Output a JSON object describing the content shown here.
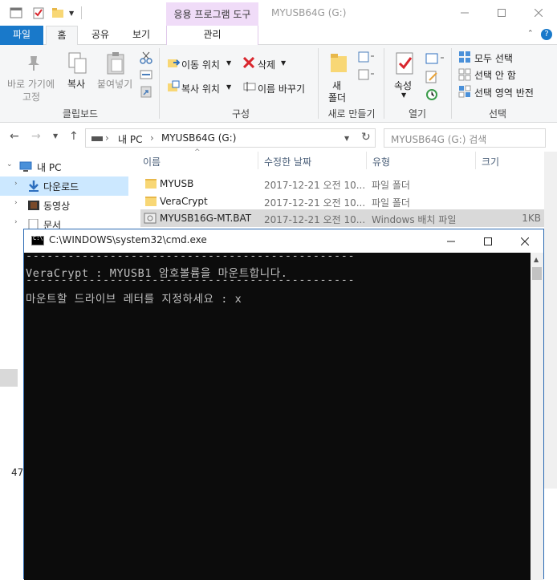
{
  "explorer": {
    "context_tab": "응용 프로그램 도구",
    "window_title": "MYUSB64G (G:)",
    "tabs": {
      "file": "파일",
      "home": "홈",
      "share": "공유",
      "view": "보기",
      "manage": "관리"
    },
    "ribbon": {
      "clipboard": {
        "pin": "바로 가기에",
        "pin2": "고정",
        "copy": "복사",
        "paste": "붙여넣기",
        "label": "클립보드"
      },
      "organize": {
        "move_to": "이동 위치",
        "copy_to": "복사 위치",
        "delete": "삭제",
        "rename": "이름 바꾸기",
        "label": "구성"
      },
      "new": {
        "new_folder": "새",
        "new_folder2": "폴더",
        "label": "새로 만들기"
      },
      "open": {
        "properties": "속성",
        "label": "열기"
      },
      "select": {
        "select_all": "모두 선택",
        "select_none": "선택 안 함",
        "invert": "선택 영역 반전",
        "label": "선택"
      }
    },
    "address": {
      "this_pc": "내 PC",
      "drive": "MYUSB64G (G:)",
      "search_placeholder": "MYUSB64G (G:) 검색"
    },
    "nav": {
      "this_pc": "내 PC",
      "downloads": "다운로드",
      "videos": "동영상",
      "documents": "문서"
    },
    "columns": {
      "name": "이름",
      "date": "수정한 날짜",
      "type": "유형",
      "size": "크기"
    },
    "files": [
      {
        "name": "MYUSB",
        "date": "2017-12-21 오전 10...",
        "type": "파일 폴더",
        "size": ""
      },
      {
        "name": "VeraCrypt",
        "date": "2017-12-21 오전 10...",
        "type": "파일 폴더",
        "size": ""
      },
      {
        "name": "MYUSB16G-MT.BAT",
        "date": "2017-12-21 오전 10...",
        "type": "Windows 배치 파일",
        "size": "1KB"
      }
    ],
    "status": "47"
  },
  "cmd": {
    "title": "C:\\WINDOWS\\system32\\cmd.exe",
    "lines": [
      "-----------------------------------------------",
      "VeraCrypt : MYUSB1 암호볼륨을 마운트합니다.",
      "-----------------------------------------------",
      "마운트할 드라이브 레터를 지정하세요 : x"
    ]
  },
  "colors": {
    "accent": "#1979ca",
    "context_tab": "#f0dcf8",
    "selection": "#cce8ff",
    "console_bg": "#0c0c0c",
    "console_fg": "#c0c0c0"
  }
}
